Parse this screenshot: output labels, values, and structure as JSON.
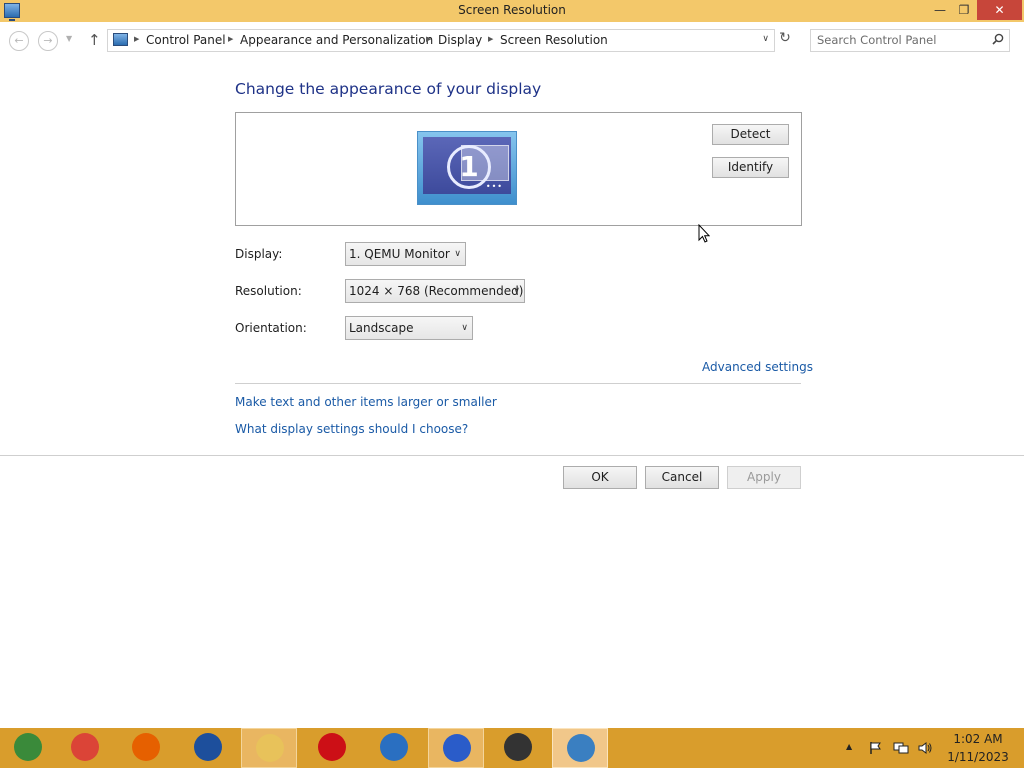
{
  "window": {
    "title": "Screen Resolution",
    "minimize_glyph": "—",
    "maximize_glyph": "❐",
    "close_glyph": "✕"
  },
  "nav": {
    "back_glyph": "←",
    "forward_glyph": "→",
    "dropdown_glyph": "▼",
    "up_glyph": "↑",
    "refresh_glyph": "↻",
    "breadcrumbs": [
      "Control Panel",
      "Appearance and Personalization",
      "Display",
      "Screen Resolution"
    ],
    "crumb_separator": "▶",
    "address_dropdown_glyph": "∨",
    "search_placeholder": "Search Control Panel"
  },
  "main": {
    "heading": "Change the appearance of your display",
    "monitor_number": "1",
    "detect_label": "Detect",
    "identify_label": "Identify",
    "display_label": "Display:",
    "display_value": "1. QEMU Monitor",
    "resolution_label": "Resolution:",
    "resolution_value": "1024 × 768 (Recommended)",
    "orientation_label": "Orientation:",
    "orientation_value": "Landscape",
    "select_arrow": "∨",
    "advanced_link": "Advanced settings",
    "text_size_link": "Make text and other items larger or smaller",
    "help_link": "What display settings should I choose?",
    "ok_label": "OK",
    "cancel_label": "Cancel",
    "apply_label": "Apply"
  },
  "taskbar": {
    "apps": [
      {
        "name": "app-1",
        "color": "#3a8a3a"
      },
      {
        "name": "chrome",
        "color": "#db4437"
      },
      {
        "name": "firefox",
        "color": "#e66000"
      },
      {
        "name": "app-blue",
        "color": "#1d4f9c"
      },
      {
        "name": "file-explorer",
        "color": "#e8c25a"
      },
      {
        "name": "opera",
        "color": "#cc0f16"
      },
      {
        "name": "thunderbird",
        "color": "#2a6fc1"
      },
      {
        "name": "app-ship",
        "color": "#2a5cc9"
      },
      {
        "name": "app-game",
        "color": "#333333"
      },
      {
        "name": "control-panel",
        "color": "#3a7fc1"
      }
    ],
    "tray_up_glyph": "▲",
    "clock_time": "1:02 AM",
    "clock_date": "1/11/2023"
  },
  "colors": {
    "titlebar": "#f3c86a",
    "taskbar": "#d99d2c",
    "heading": "#1e3287",
    "link": "#1a5aa6",
    "close_button": "#c7463a"
  }
}
